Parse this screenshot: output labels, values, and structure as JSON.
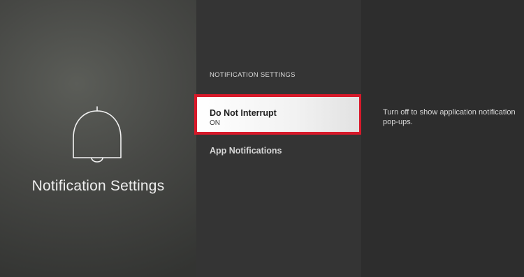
{
  "app": {
    "panel_title": "Notification Settings",
    "icon": "bell-icon"
  },
  "menu": {
    "section_header": "NOTIFICATION SETTINGS",
    "items": [
      {
        "label": "Do Not Interrupt",
        "value": "ON",
        "selected": true
      },
      {
        "label": "App Notifications",
        "selected": false
      }
    ]
  },
  "detail": {
    "description": "Turn off to show application notification pop-ups."
  },
  "colors": {
    "focus_border": "#d8192a",
    "selected_bg": "#f2f2f2",
    "text_light": "#eeeeee"
  }
}
